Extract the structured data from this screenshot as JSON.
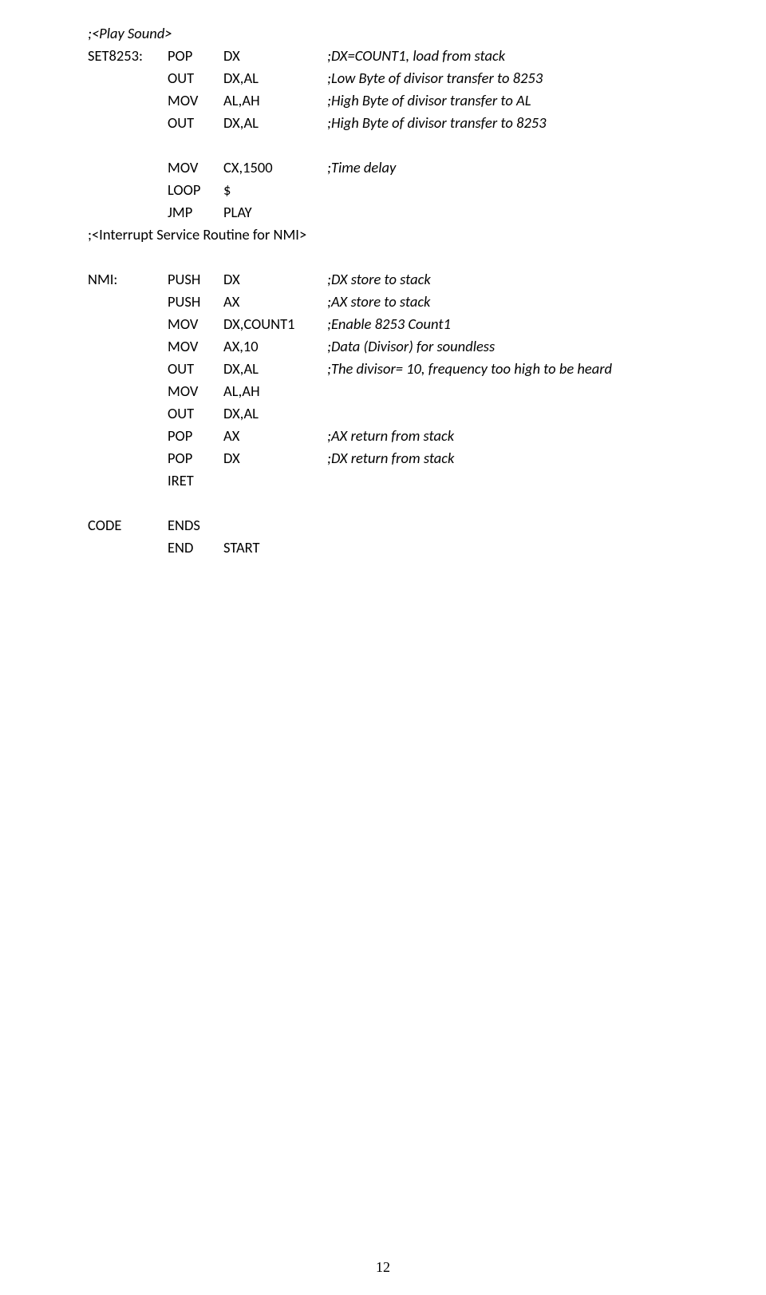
{
  "sections": {
    "play_sound_header": ";<Play Sound>",
    "interrupt_header": ";<Interrupt Service Routine for NMI>"
  },
  "block1": [
    {
      "label": "SET8253:",
      "op": "POP",
      "arg": "DX",
      "comment": ";DX=COUNT1, load from stack"
    },
    {
      "label": "",
      "op": "OUT",
      "arg": "DX,AL",
      "comment": ";Low Byte of divisor transfer to 8253"
    },
    {
      "label": "",
      "op": "MOV",
      "arg": "AL,AH",
      "comment": ";High Byte of divisor transfer to AL"
    },
    {
      "label": "",
      "op": "OUT",
      "arg": "DX,AL",
      "comment": ";High Byte of divisor transfer to 8253"
    }
  ],
  "block2": [
    {
      "label": "",
      "op": "MOV",
      "arg": "CX,1500",
      "comment": ";Time delay"
    },
    {
      "label": "",
      "op": "LOOP",
      "arg": "$",
      "comment": ""
    },
    {
      "label": "",
      "op": "JMP",
      "arg": "PLAY",
      "comment": ""
    }
  ],
  "block3": [
    {
      "label": "NMI:",
      "op": "PUSH",
      "arg": "DX",
      "comment": ";DX store to stack"
    },
    {
      "label": "",
      "op": "PUSH",
      "arg": "AX",
      "comment": ";AX store to stack"
    },
    {
      "label": "",
      "op": "MOV",
      "arg": "DX,COUNT1",
      "comment": ";Enable 8253 Count1"
    },
    {
      "label": "",
      "op": "MOV",
      "arg": "AX,10",
      "comment": ";Data (Divisor) for soundless"
    },
    {
      "label": "",
      "op": "OUT",
      "arg": "DX,AL",
      "comment": ";The divisor= 10, frequency too high to be heard"
    },
    {
      "label": "",
      "op": "MOV",
      "arg": "AL,AH",
      "comment": ""
    },
    {
      "label": "",
      "op": "OUT",
      "arg": "DX,AL",
      "comment": ""
    },
    {
      "label": "",
      "op": "POP",
      "arg": "AX",
      "comment": ";AX return from stack"
    },
    {
      "label": "",
      "op": "POP",
      "arg": "DX",
      "comment": ";DX return from stack"
    },
    {
      "label": "",
      "op": "IRET",
      "arg": "",
      "comment": ""
    }
  ],
  "block4": [
    {
      "label": "CODE",
      "op": "ENDS",
      "arg": "",
      "comment": ""
    },
    {
      "label": "",
      "op": "END",
      "arg": "START",
      "comment": ""
    }
  ],
  "page_number": "12"
}
